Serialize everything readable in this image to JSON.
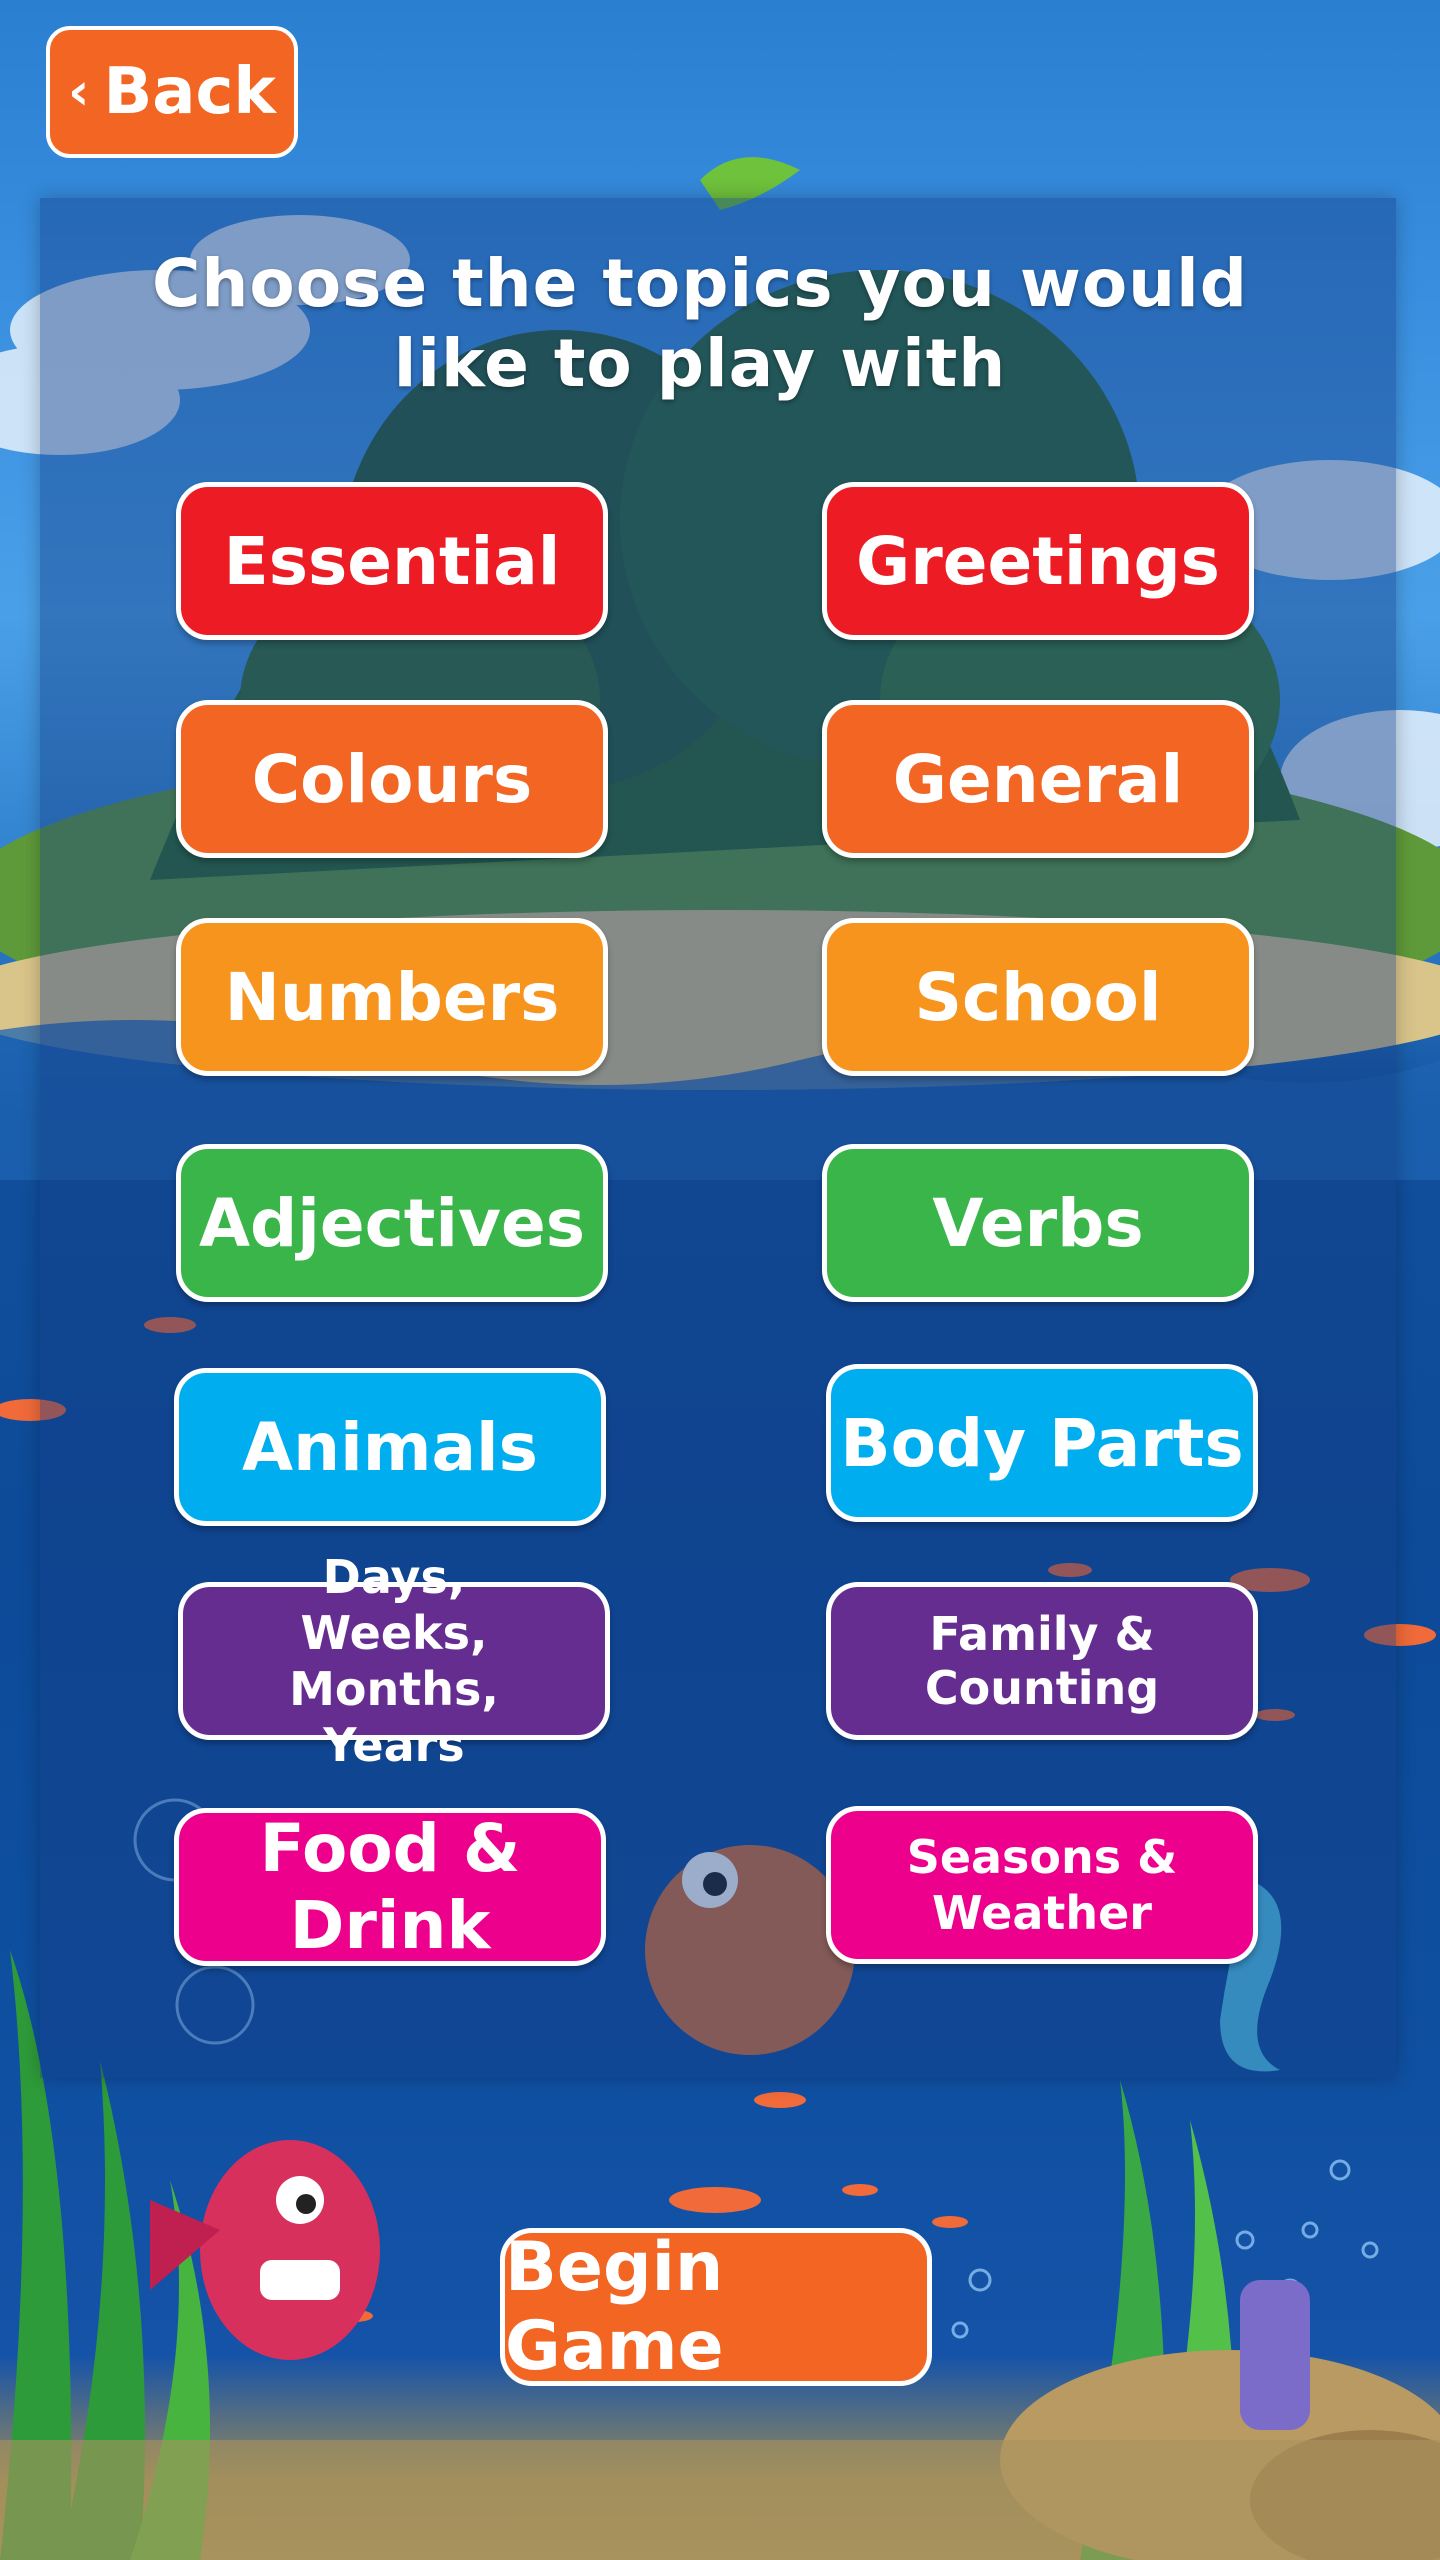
{
  "header": {
    "back_label": "Back"
  },
  "heading": "Choose the topics you would like to play with",
  "topics": [
    {
      "label": "Essential",
      "color": "#ed1c24"
    },
    {
      "label": "Greetings",
      "color": "#ed1c24"
    },
    {
      "label": "Colours",
      "color": "#f26522"
    },
    {
      "label": "General",
      "color": "#f26522"
    },
    {
      "label": "Numbers",
      "color": "#f7941d"
    },
    {
      "label": "School",
      "color": "#f7941d"
    },
    {
      "label": "Adjectives",
      "color": "#39b54a"
    },
    {
      "label": "Verbs",
      "color": "#39b54a"
    },
    {
      "label": "Animals",
      "color": "#00aeef"
    },
    {
      "label": "Body Parts",
      "color": "#00aeef"
    },
    {
      "label": "Days, Weeks, Months, Years",
      "color": "#662d91"
    },
    {
      "label": "Family & Counting",
      "color": "#662d91"
    },
    {
      "label": "Food & Drink",
      "color": "#ec008c"
    },
    {
      "label": "Seasons & Weather",
      "color": "#ec008c"
    }
  ],
  "footer": {
    "begin_label": "Begin Game"
  },
  "colors": {
    "accent": "#f26522",
    "text": "#ffffff"
  }
}
